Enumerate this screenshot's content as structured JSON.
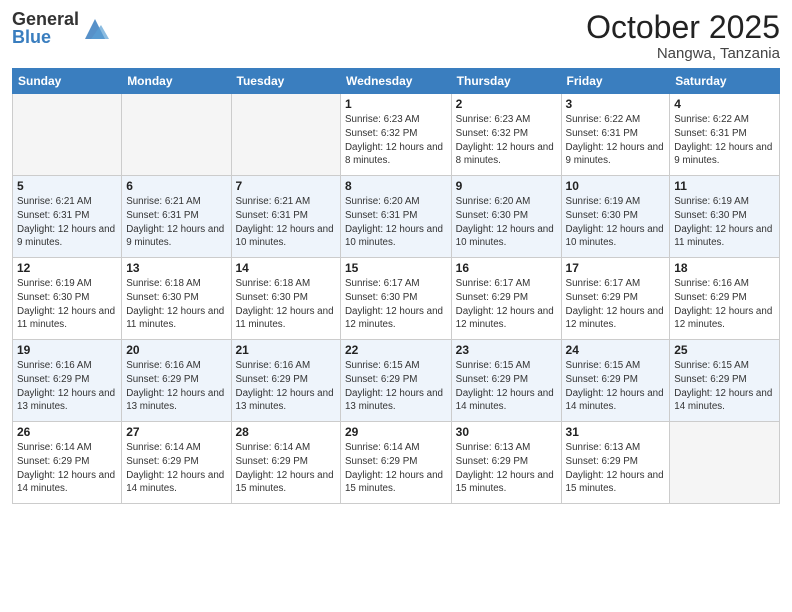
{
  "logo": {
    "general": "General",
    "blue": "Blue"
  },
  "header": {
    "month": "October 2025",
    "location": "Nangwa, Tanzania"
  },
  "weekdays": [
    "Sunday",
    "Monday",
    "Tuesday",
    "Wednesday",
    "Thursday",
    "Friday",
    "Saturday"
  ],
  "weeks": [
    [
      {
        "day": "",
        "empty": true
      },
      {
        "day": "",
        "empty": true
      },
      {
        "day": "",
        "empty": true
      },
      {
        "day": "1",
        "sunrise": "6:23 AM",
        "sunset": "6:32 PM",
        "daylight": "12 hours and 8 minutes."
      },
      {
        "day": "2",
        "sunrise": "6:23 AM",
        "sunset": "6:32 PM",
        "daylight": "12 hours and 8 minutes."
      },
      {
        "day": "3",
        "sunrise": "6:22 AM",
        "sunset": "6:31 PM",
        "daylight": "12 hours and 9 minutes."
      },
      {
        "day": "4",
        "sunrise": "6:22 AM",
        "sunset": "6:31 PM",
        "daylight": "12 hours and 9 minutes."
      }
    ],
    [
      {
        "day": "5",
        "sunrise": "6:21 AM",
        "sunset": "6:31 PM",
        "daylight": "12 hours and 9 minutes."
      },
      {
        "day": "6",
        "sunrise": "6:21 AM",
        "sunset": "6:31 PM",
        "daylight": "12 hours and 9 minutes."
      },
      {
        "day": "7",
        "sunrise": "6:21 AM",
        "sunset": "6:31 PM",
        "daylight": "12 hours and 10 minutes."
      },
      {
        "day": "8",
        "sunrise": "6:20 AM",
        "sunset": "6:31 PM",
        "daylight": "12 hours and 10 minutes."
      },
      {
        "day": "9",
        "sunrise": "6:20 AM",
        "sunset": "6:30 PM",
        "daylight": "12 hours and 10 minutes."
      },
      {
        "day": "10",
        "sunrise": "6:19 AM",
        "sunset": "6:30 PM",
        "daylight": "12 hours and 10 minutes."
      },
      {
        "day": "11",
        "sunrise": "6:19 AM",
        "sunset": "6:30 PM",
        "daylight": "12 hours and 11 minutes."
      }
    ],
    [
      {
        "day": "12",
        "sunrise": "6:19 AM",
        "sunset": "6:30 PM",
        "daylight": "12 hours and 11 minutes."
      },
      {
        "day": "13",
        "sunrise": "6:18 AM",
        "sunset": "6:30 PM",
        "daylight": "12 hours and 11 minutes."
      },
      {
        "day": "14",
        "sunrise": "6:18 AM",
        "sunset": "6:30 PM",
        "daylight": "12 hours and 11 minutes."
      },
      {
        "day": "15",
        "sunrise": "6:17 AM",
        "sunset": "6:30 PM",
        "daylight": "12 hours and 12 minutes."
      },
      {
        "day": "16",
        "sunrise": "6:17 AM",
        "sunset": "6:29 PM",
        "daylight": "12 hours and 12 minutes."
      },
      {
        "day": "17",
        "sunrise": "6:17 AM",
        "sunset": "6:29 PM",
        "daylight": "12 hours and 12 minutes."
      },
      {
        "day": "18",
        "sunrise": "6:16 AM",
        "sunset": "6:29 PM",
        "daylight": "12 hours and 12 minutes."
      }
    ],
    [
      {
        "day": "19",
        "sunrise": "6:16 AM",
        "sunset": "6:29 PM",
        "daylight": "12 hours and 13 minutes."
      },
      {
        "day": "20",
        "sunrise": "6:16 AM",
        "sunset": "6:29 PM",
        "daylight": "12 hours and 13 minutes."
      },
      {
        "day": "21",
        "sunrise": "6:16 AM",
        "sunset": "6:29 PM",
        "daylight": "12 hours and 13 minutes."
      },
      {
        "day": "22",
        "sunrise": "6:15 AM",
        "sunset": "6:29 PM",
        "daylight": "12 hours and 13 minutes."
      },
      {
        "day": "23",
        "sunrise": "6:15 AM",
        "sunset": "6:29 PM",
        "daylight": "12 hours and 14 minutes."
      },
      {
        "day": "24",
        "sunrise": "6:15 AM",
        "sunset": "6:29 PM",
        "daylight": "12 hours and 14 minutes."
      },
      {
        "day": "25",
        "sunrise": "6:15 AM",
        "sunset": "6:29 PM",
        "daylight": "12 hours and 14 minutes."
      }
    ],
    [
      {
        "day": "26",
        "sunrise": "6:14 AM",
        "sunset": "6:29 PM",
        "daylight": "12 hours and 14 minutes."
      },
      {
        "day": "27",
        "sunrise": "6:14 AM",
        "sunset": "6:29 PM",
        "daylight": "12 hours and 14 minutes."
      },
      {
        "day": "28",
        "sunrise": "6:14 AM",
        "sunset": "6:29 PM",
        "daylight": "12 hours and 15 minutes."
      },
      {
        "day": "29",
        "sunrise": "6:14 AM",
        "sunset": "6:29 PM",
        "daylight": "12 hours and 15 minutes."
      },
      {
        "day": "30",
        "sunrise": "6:13 AM",
        "sunset": "6:29 PM",
        "daylight": "12 hours and 15 minutes."
      },
      {
        "day": "31",
        "sunrise": "6:13 AM",
        "sunset": "6:29 PM",
        "daylight": "12 hours and 15 minutes."
      },
      {
        "day": "",
        "empty": true
      }
    ]
  ],
  "labels": {
    "sunrise": "Sunrise:",
    "sunset": "Sunset:",
    "daylight": "Daylight:"
  }
}
